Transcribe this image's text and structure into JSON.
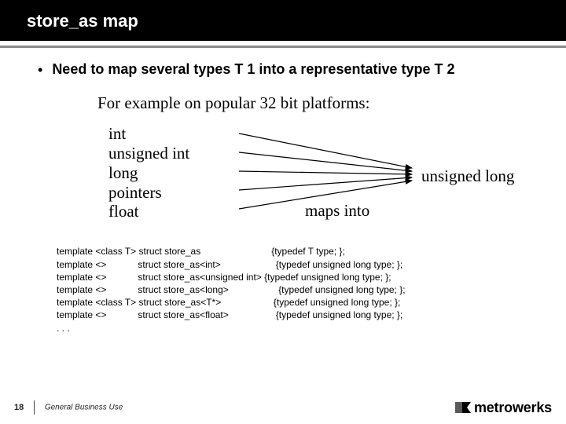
{
  "title": "store_as map",
  "bullet_text": "Need to map several types T 1 into a representative type T 2",
  "subtitle": "For example on popular 32 bit platforms:",
  "source_types": {
    "t0": "int",
    "t1": "unsigned int",
    "t2": "long",
    "t3": "pointers",
    "t4": "float"
  },
  "target_type": "unsigned long",
  "maps_into": "maps into",
  "code": {
    "l0": "template <class T> struct store_as                           {typedef T type; };",
    "l1": "template <>            struct store_as<int>                     {typedef unsigned long type; };",
    "l2": "template <>            struct store_as<unsigned int> {typedef unsigned long type; };",
    "l3": "template <>            struct store_as<long>                   {typedef unsigned long type; };",
    "l4": "template <class T> struct store_as<T*>                    {typedef unsigned long type; };",
    "l5": "template <>            struct store_as<float>                  {typedef unsigned long type; };",
    "l6": ". . ."
  },
  "footer": {
    "page": "18",
    "classification": "General Business Use"
  },
  "logo_text": "metrowerks"
}
